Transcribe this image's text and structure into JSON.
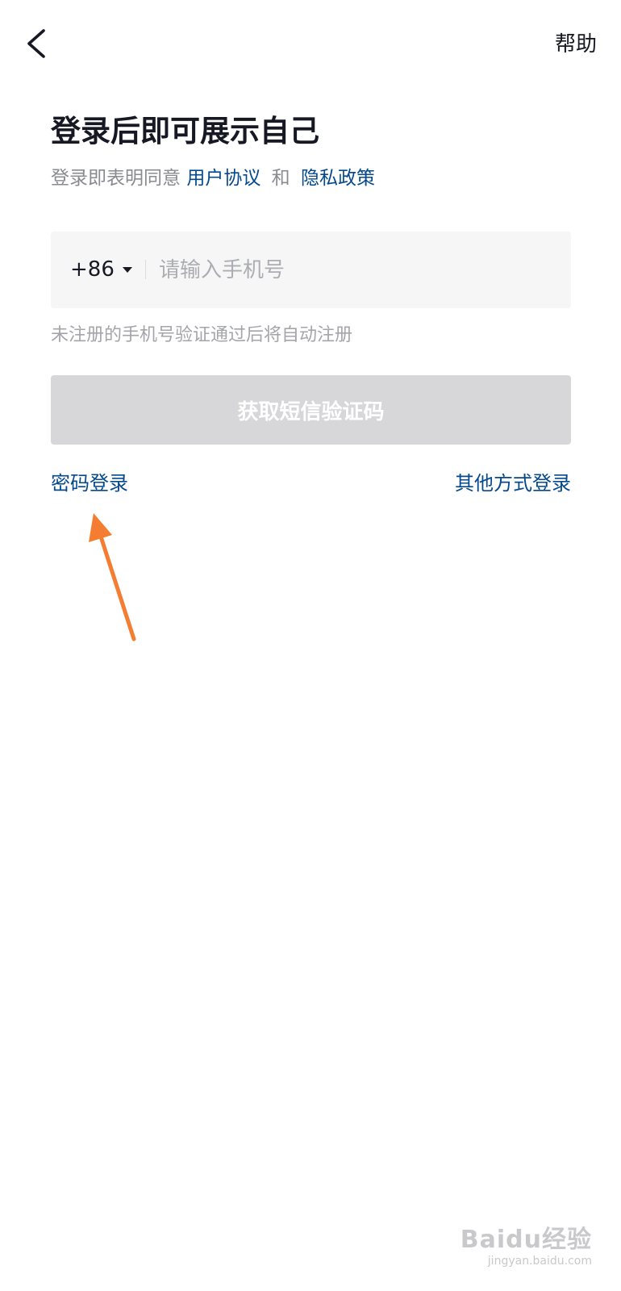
{
  "header": {
    "back_icon": "chevron-left-icon",
    "help_label": "帮助"
  },
  "main": {
    "title": "登录后即可展示自己",
    "agreement": {
      "prefix": "登录即表明同意",
      "user_agreement": "用户协议",
      "conjunction": "和",
      "privacy_policy": "隐私政策"
    },
    "phone": {
      "country_code": "+86",
      "placeholder": "请输入手机号",
      "value": ""
    },
    "hint": "未注册的手机号验证通过后将自动注册",
    "sms_button_label": "获取短信验证码",
    "password_login_label": "密码登录",
    "other_login_label": "其他方式登录"
  },
  "annotation": {
    "arrow_color": "#f47d31"
  },
  "watermark": {
    "main": "Baidu经验",
    "sub": "jingyan.baidu.com"
  },
  "colors": {
    "text_primary": "#161823",
    "link": "#04498d",
    "button_disabled": "#d7d7d9",
    "input_bg": "#f6f6f7"
  }
}
